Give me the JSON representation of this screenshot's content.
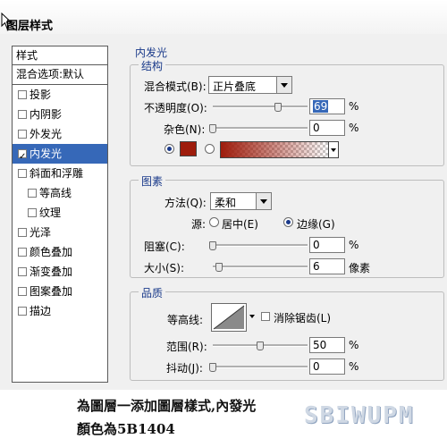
{
  "window": {
    "title": "图层样式"
  },
  "sidebar": {
    "header": "样式",
    "blend_options": "混合选项:默认",
    "items": [
      {
        "label": "投影",
        "checked": false,
        "active": false,
        "indent": false
      },
      {
        "label": "内阴影",
        "checked": false,
        "active": false,
        "indent": false
      },
      {
        "label": "外发光",
        "checked": false,
        "active": false,
        "indent": false
      },
      {
        "label": "内发光",
        "checked": true,
        "active": true,
        "indent": false
      },
      {
        "label": "斜面和浮雕",
        "checked": false,
        "active": false,
        "indent": false
      },
      {
        "label": "等高线",
        "checked": false,
        "active": false,
        "indent": true
      },
      {
        "label": "纹理",
        "checked": false,
        "active": false,
        "indent": true
      },
      {
        "label": "光泽",
        "checked": false,
        "active": false,
        "indent": false
      },
      {
        "label": "颜色叠加",
        "checked": false,
        "active": false,
        "indent": false
      },
      {
        "label": "渐变叠加",
        "checked": false,
        "active": false,
        "indent": false
      },
      {
        "label": "图案叠加",
        "checked": false,
        "active": false,
        "indent": false
      },
      {
        "label": "描边",
        "checked": false,
        "active": false,
        "indent": false
      }
    ]
  },
  "panel": {
    "title": "内发光",
    "structure": {
      "title": "结构",
      "blend_mode_label": "混合模式(B):",
      "blend_mode_value": "正片叠底",
      "opacity_label": "不透明度(O):",
      "opacity_value": "69",
      "opacity_percent": 0.69,
      "noise_label": "杂色(N):",
      "noise_value": "0",
      "noise_percent": 0,
      "percent": "%",
      "glow_color": "#9e1c0c"
    },
    "elements": {
      "title": "图素",
      "technique_label": "方法(Q):",
      "technique_value": "柔和",
      "source_label": "源:",
      "source_center": "居中(E)",
      "source_edge": "边缘(G)",
      "choke_label": "阻塞(C):",
      "choke_value": "0",
      "choke_percent": 0,
      "size_label": "大小(S):",
      "size_value": "6",
      "size_unit": "像素",
      "percent": "%"
    },
    "quality": {
      "title": "品质",
      "contour_label": "等高线:",
      "antialias_label": "消除锯齿(L)",
      "range_label": "范围(R):",
      "range_value": "50",
      "range_percent": 0.5,
      "jitter_label": "抖动(J):",
      "jitter_value": "0",
      "jitter_percent": 0,
      "percent": "%"
    }
  },
  "caption": {
    "line1": "為圖層一添加圖層樣式,內發光",
    "line2": "顏色為5B1404"
  },
  "watermark": "SBIWUPM"
}
